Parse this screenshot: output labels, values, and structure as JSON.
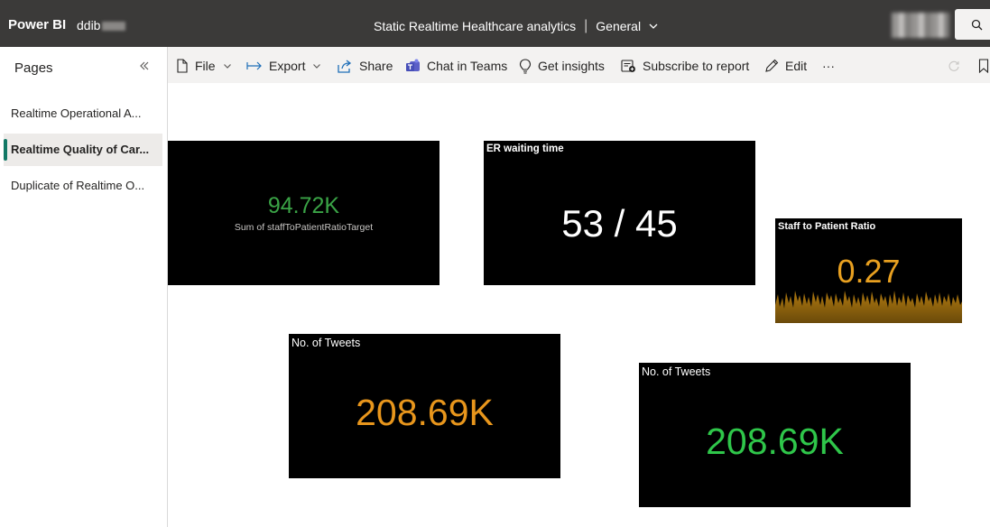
{
  "topbar": {
    "brand": "Power BI",
    "workspace": "ddib",
    "report_title": "Static Realtime Healthcare analytics",
    "separator": "|",
    "environment": "General"
  },
  "sidebar": {
    "title": "Pages",
    "items": [
      {
        "label": "Realtime Operational A...",
        "active": false
      },
      {
        "label": "Realtime Quality of Car...",
        "active": true
      },
      {
        "label": "Duplicate of Realtime O...",
        "active": false
      }
    ]
  },
  "toolbar": {
    "file": "File",
    "export": "Export",
    "share": "Share",
    "chat_in_teams": "Chat in Teams",
    "get_insights": "Get insights",
    "subscribe": "Subscribe to report",
    "edit": "Edit",
    "more": "···"
  },
  "cards": {
    "staff_target": {
      "value": "94.72K",
      "label": "Sum of staffToPatientRatioTarget",
      "color": "#3aa346"
    },
    "er_wait": {
      "title": "ER waiting time",
      "value": "53 / 45",
      "color": "#ffffff"
    },
    "staff_ratio": {
      "title": "Staff to Patient Ratio",
      "value": "0.27",
      "color": "#e8a020"
    },
    "tweets_orange": {
      "title": "No. of Tweets",
      "value": "208.69K",
      "color": "#e8961c"
    },
    "tweets_green": {
      "title": "No. of Tweets",
      "value": "208.69K",
      "color": "#2fc64a"
    }
  },
  "colors": {
    "topbar": "#3b3a39",
    "active_page_accent": "#117865",
    "card_bg": "#000000"
  }
}
